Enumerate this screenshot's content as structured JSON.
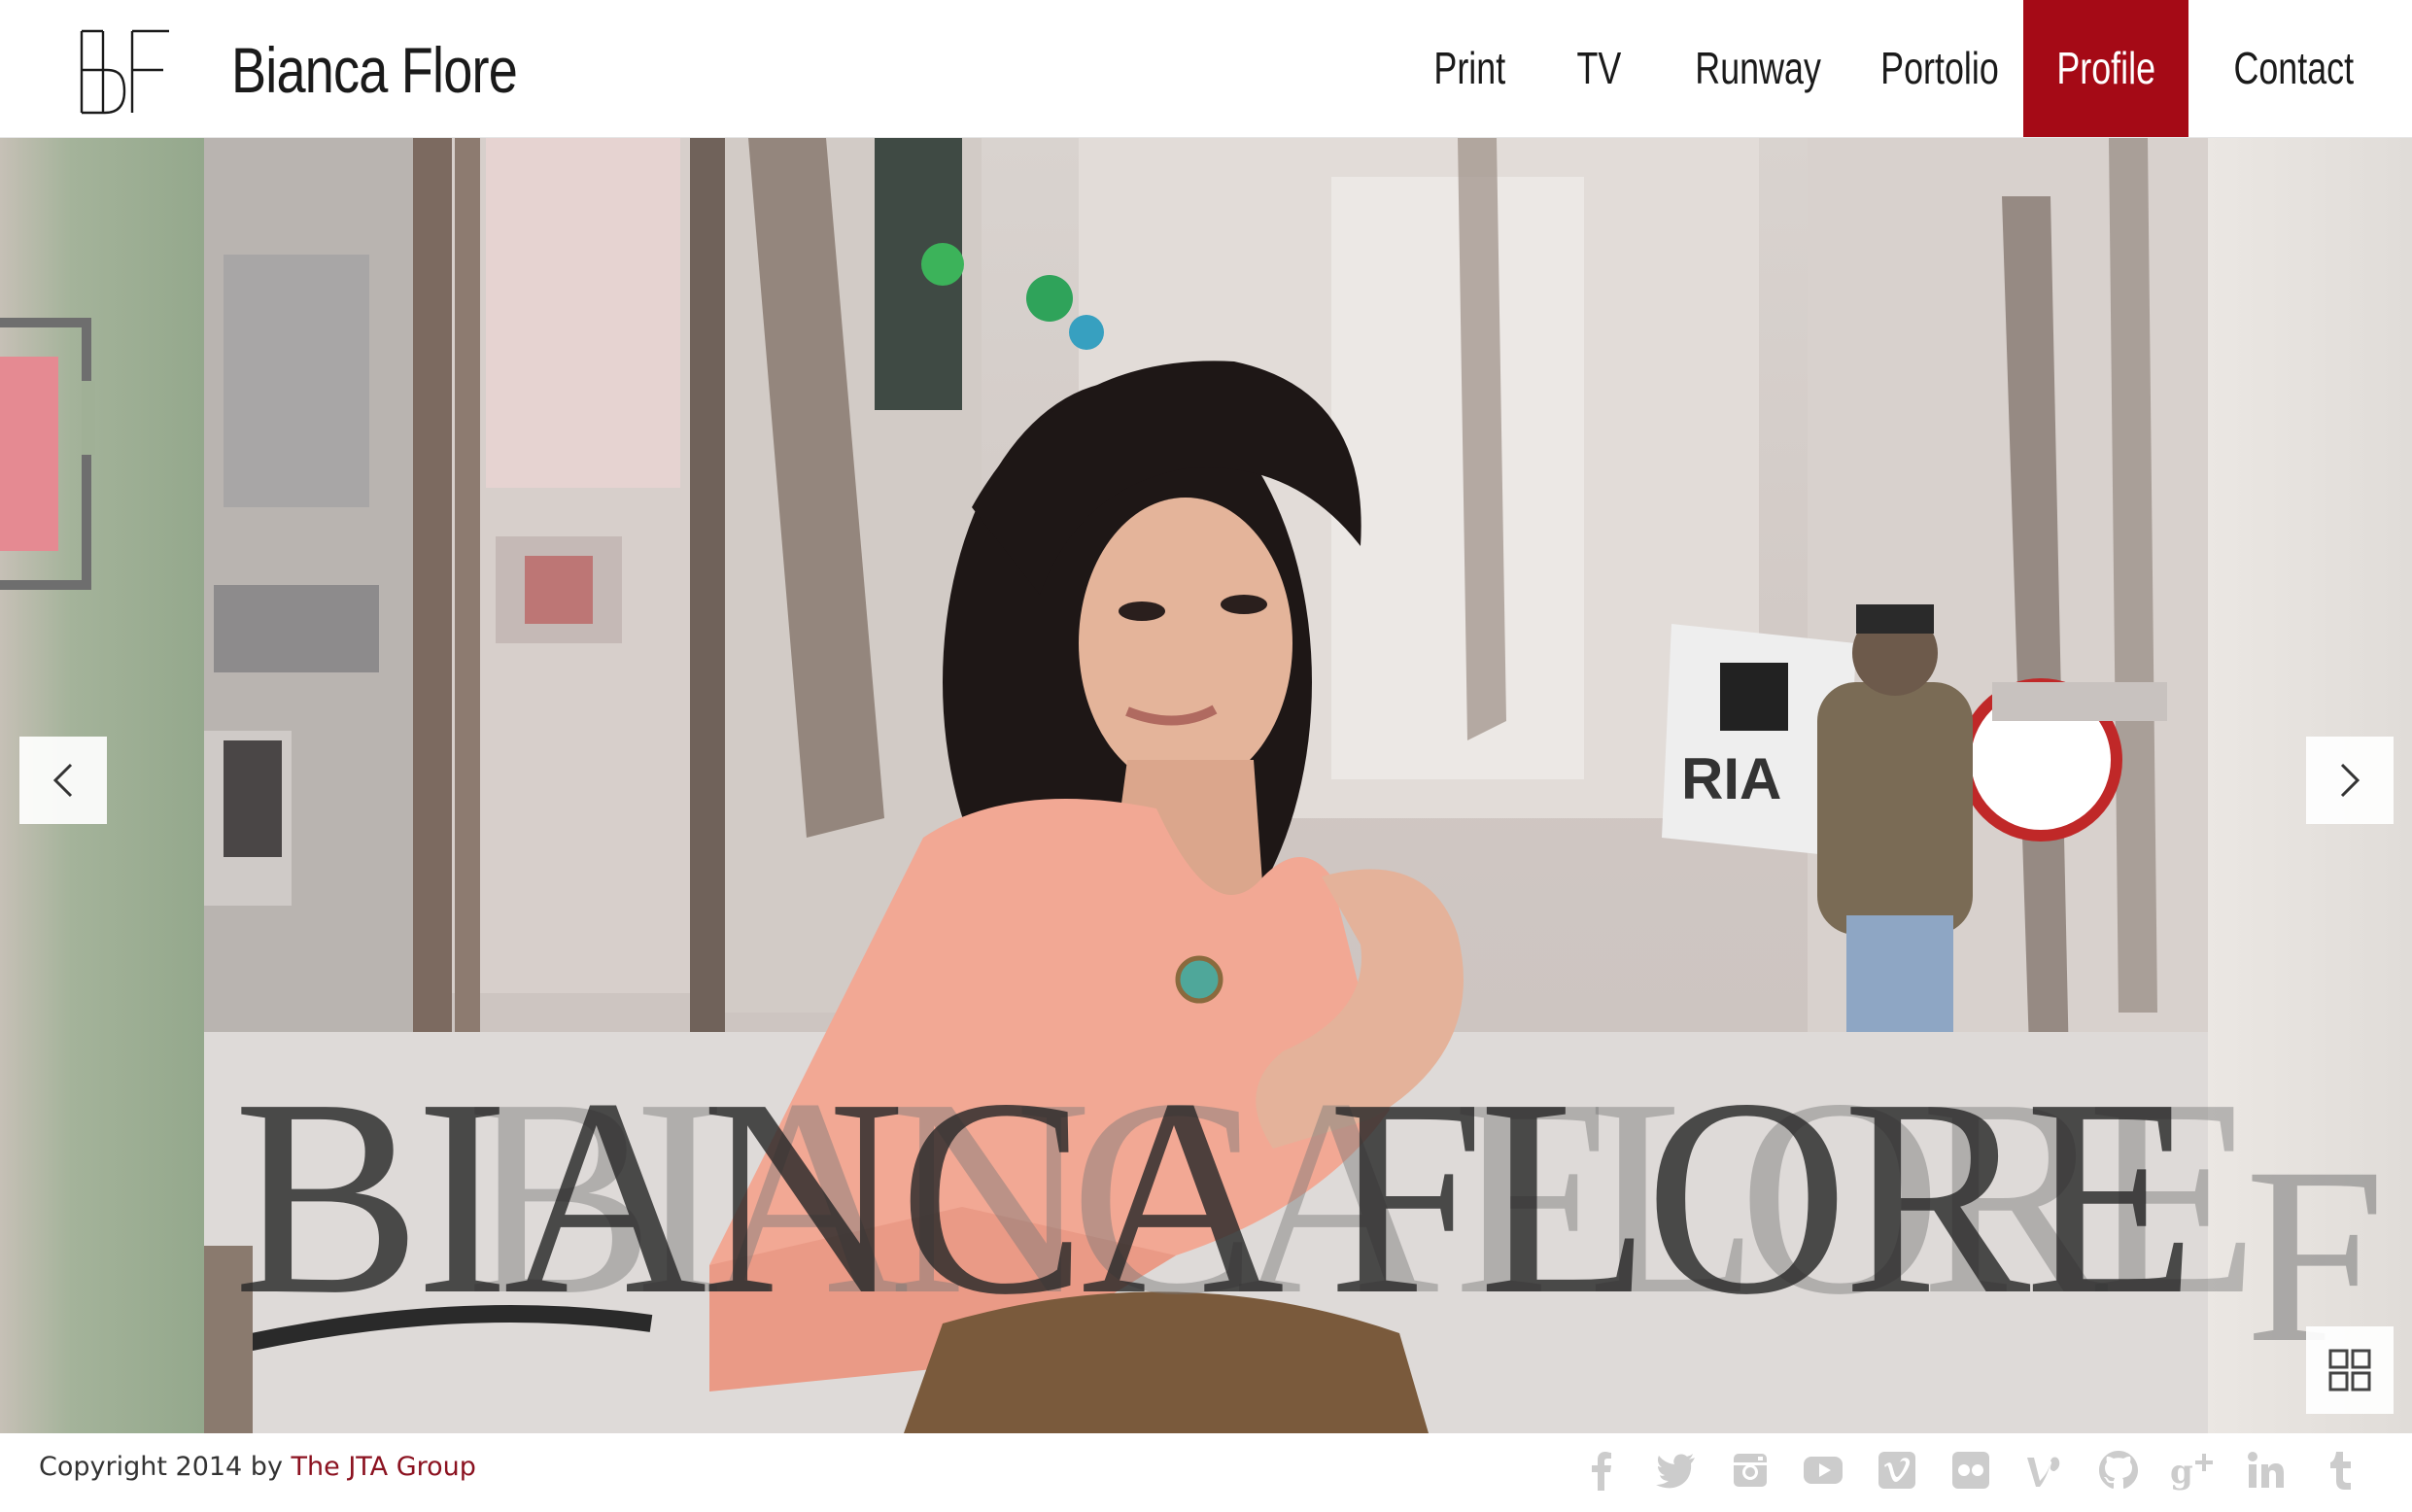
{
  "header": {
    "site_title": "Bianca Flore",
    "logo_alt": "BF",
    "nav": [
      {
        "label": "Print",
        "active": false
      },
      {
        "label": "TV",
        "active": false
      },
      {
        "label": "Runway",
        "active": false
      },
      {
        "label": "Portolio",
        "active": false
      },
      {
        "label": "Profile",
        "active": true
      },
      {
        "label": "Contact",
        "active": false
      }
    ],
    "accent_color": "#a50a16"
  },
  "slider": {
    "hero_name": "BIANCA FLORE",
    "prev_icon": "chevron-left-icon",
    "next_icon": "chevron-right-icon",
    "grid_icon": "grid-view-icon"
  },
  "footer": {
    "copyright_prefix": "Copyright 2014 by ",
    "copyright_link": "The JTA Group",
    "social_icons": [
      "facebook-icon",
      "twitter-icon",
      "instagram-icon",
      "youtube-icon",
      "vimeo-icon",
      "flickr-icon",
      "vine-icon",
      "github-icon",
      "google-plus-icon",
      "linkedin-icon",
      "tumblr-icon"
    ]
  }
}
